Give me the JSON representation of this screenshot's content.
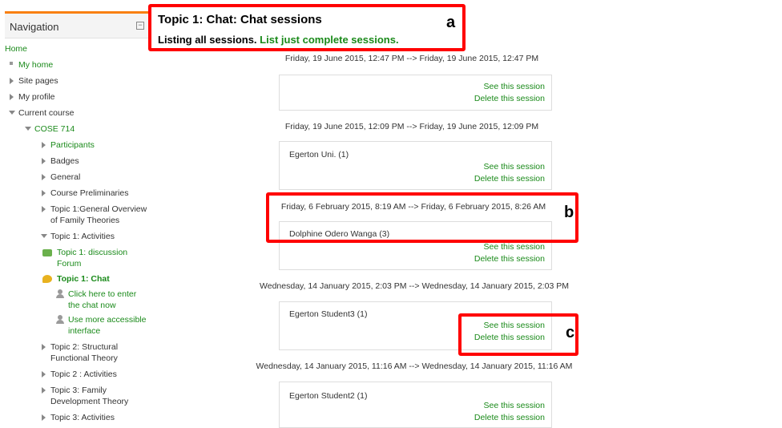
{
  "navigation": {
    "title": "Navigation",
    "collapse_glyph": "−",
    "items": [
      {
        "label": "Home"
      },
      {
        "label": "My home"
      },
      {
        "label": "Site pages"
      },
      {
        "label": "My profile"
      },
      {
        "label": "Current course"
      },
      {
        "label": "COSE 714"
      },
      {
        "label": "Participants"
      },
      {
        "label": "Badges"
      },
      {
        "label": "General"
      },
      {
        "label": "Course Preliminaries"
      },
      {
        "label": "Topic 1:General Overview",
        "label2": "of Family Theories"
      },
      {
        "label": "Topic 1: Activities"
      },
      {
        "label": "Topic 1: discussion",
        "label2": "Forum"
      },
      {
        "label": "Topic 1: Chat"
      },
      {
        "label": "Click here to enter",
        "label2": "the chat now"
      },
      {
        "label": "Use more accessible",
        "label2": "interface"
      },
      {
        "label": "Topic 2: Structural",
        "label2": "Functional Theory"
      },
      {
        "label": "Topic 2 : Activities"
      },
      {
        "label": "Topic 3: Family",
        "label2": "Development Theory"
      },
      {
        "label": "Topic 3: Activities"
      }
    ]
  },
  "main": {
    "title": "Topic 1: Chat: Chat sessions",
    "listing_text": "Listing all sessions.",
    "listing_link": "List just complete sessions.",
    "see_label": "See this session",
    "delete_label": "Delete this session",
    "sessions": [
      {
        "date": "Friday, 19 June 2015, 12:47 PM --> Friday, 19 June 2015, 12:47 PM",
        "user": ""
      },
      {
        "date": "Friday, 19 June 2015, 12:09 PM --> Friday, 19 June 2015, 12:09 PM",
        "user": "Egerton Uni. (1)"
      },
      {
        "date": "Friday, 6 February 2015, 8:19 AM --> Friday, 6 February 2015, 8:26 AM",
        "user": "Dolphine Odero Wanga (3)"
      },
      {
        "date": "Wednesday, 14 January 2015, 2:03 PM --> Wednesday, 14 January 2015, 2:03 PM",
        "user": "Egerton Student3 (1)"
      },
      {
        "date": "Wednesday, 14 January 2015, 11:16 AM --> Wednesday, 14 January 2015, 11:16 AM",
        "user": "Egerton Student2 (1)"
      }
    ]
  },
  "annotations": {
    "a": "a",
    "b": "b",
    "c": "c",
    "color": "#ff0000"
  },
  "colors": {
    "link_green": "#1a8a1a",
    "accent_orange": "#f98012"
  }
}
